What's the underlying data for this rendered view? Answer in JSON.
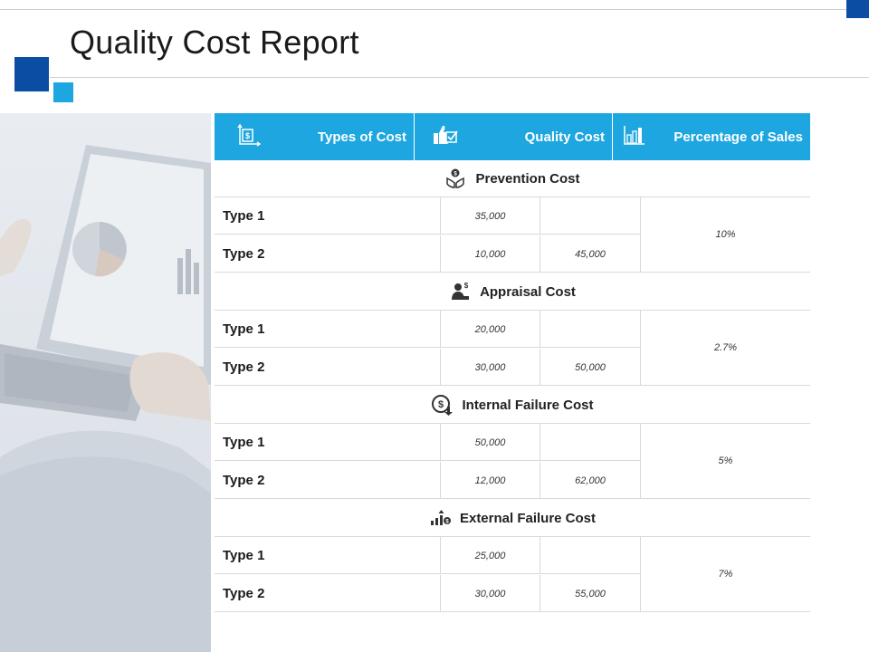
{
  "slide": {
    "title": "Quality Cost Report"
  },
  "colors": {
    "accent_dark": "#0b4da2",
    "accent_light": "#1ea6e0",
    "header_text": "#ffffff"
  },
  "table": {
    "headers": {
      "types": "Types of Cost",
      "quality": "Quality Cost",
      "percentage": "Percentage of Sales"
    },
    "header_icons": [
      "money-growth-icon",
      "thumbs-up-check-icon",
      "bar-chart-icon"
    ],
    "sections": [
      {
        "title": "Prevention Cost",
        "icon": "hands-dollar-icon",
        "rows": [
          {
            "type": "Type 1",
            "cost": "35,000",
            "total": ""
          },
          {
            "type": "Type 2",
            "cost": "10,000",
            "total": "45,000"
          }
        ],
        "percentage": "10%"
      },
      {
        "title": "Appraisal Cost",
        "icon": "person-dollar-icon",
        "rows": [
          {
            "type": "Type 1",
            "cost": "20,000",
            "total": ""
          },
          {
            "type": "Type 2",
            "cost": "30,000",
            "total": "50,000"
          }
        ],
        "percentage": "2.7%"
      },
      {
        "title": "Internal Failure Cost",
        "icon": "dollar-down-icon",
        "rows": [
          {
            "type": "Type 1",
            "cost": "50,000",
            "total": ""
          },
          {
            "type": "Type 2",
            "cost": "12,000",
            "total": "62,000"
          }
        ],
        "percentage": "5%"
      },
      {
        "title": "External Failure Cost",
        "icon": "chart-dollar-icon",
        "rows": [
          {
            "type": "Type 1",
            "cost": "25,000",
            "total": ""
          },
          {
            "type": "Type 2",
            "cost": "30,000",
            "total": "55,000"
          }
        ],
        "percentage": "7%"
      }
    ]
  }
}
